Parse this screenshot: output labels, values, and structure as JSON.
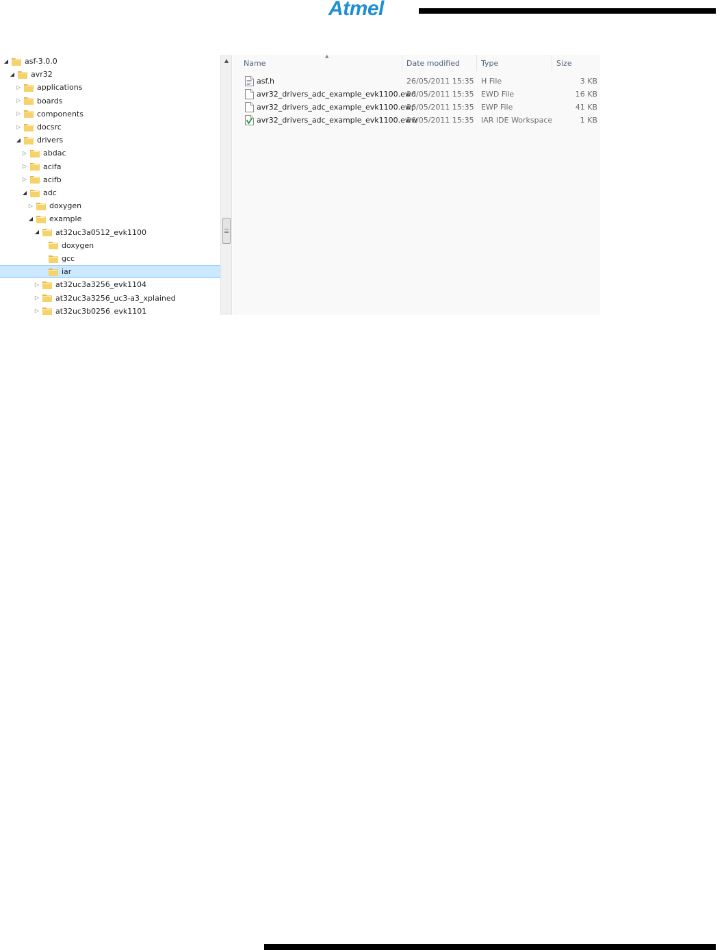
{
  "header": {
    "logo_text": "Atmel"
  },
  "explorer": {
    "tree": [
      {
        "label": "asf-3.0.0",
        "depth": 0,
        "state": "expanded",
        "selected": false
      },
      {
        "label": "avr32",
        "depth": 1,
        "state": "expanded",
        "selected": false
      },
      {
        "label": "applications",
        "depth": 2,
        "state": "collapsed",
        "selected": false
      },
      {
        "label": "boards",
        "depth": 2,
        "state": "collapsed",
        "selected": false
      },
      {
        "label": "components",
        "depth": 2,
        "state": "collapsed",
        "selected": false
      },
      {
        "label": "docsrc",
        "depth": 2,
        "state": "collapsed",
        "selected": false
      },
      {
        "label": "drivers",
        "depth": 2,
        "state": "expanded",
        "selected": false
      },
      {
        "label": "abdac",
        "depth": 3,
        "state": "collapsed",
        "selected": false
      },
      {
        "label": "acifa",
        "depth": 3,
        "state": "collapsed",
        "selected": false
      },
      {
        "label": "acifb",
        "depth": 3,
        "state": "collapsed",
        "selected": false
      },
      {
        "label": "adc",
        "depth": 3,
        "state": "expanded",
        "selected": false
      },
      {
        "label": "doxygen",
        "depth": 4,
        "state": "collapsed",
        "selected": false
      },
      {
        "label": "example",
        "depth": 4,
        "state": "expanded",
        "selected": false
      },
      {
        "label": "at32uc3a0512_evk1100",
        "depth": 5,
        "state": "expanded",
        "selected": false
      },
      {
        "label": "doxygen",
        "depth": 6,
        "state": "none",
        "selected": false
      },
      {
        "label": "gcc",
        "depth": 6,
        "state": "none",
        "selected": false
      },
      {
        "label": "iar",
        "depth": 6,
        "state": "none",
        "selected": true
      },
      {
        "label": "at32uc3a3256_evk1104",
        "depth": 5,
        "state": "collapsed",
        "selected": false
      },
      {
        "label": "at32uc3a3256_uc3-a3_xplained",
        "depth": 5,
        "state": "collapsed",
        "selected": false
      },
      {
        "label": "at32uc3b0256_evk1101",
        "depth": 5,
        "state": "collapsed",
        "selected": false
      }
    ],
    "columns": {
      "name": "Name",
      "date": "Date modified",
      "type": "Type",
      "size": "Size"
    },
    "files": [
      {
        "name": "asf.h",
        "date": "26/05/2011 15:35",
        "type": "H File",
        "size": "3 KB",
        "icon": "text-file-icon"
      },
      {
        "name": "avr32_drivers_adc_example_evk1100.ewd",
        "date": "26/05/2011 15:35",
        "type": "EWD File",
        "size": "16 KB",
        "icon": "blank-file-icon"
      },
      {
        "name": "avr32_drivers_adc_example_evk1100.ewp",
        "date": "26/05/2011 15:35",
        "type": "EWP File",
        "size": "41 KB",
        "icon": "blank-file-icon"
      },
      {
        "name": "avr32_drivers_adc_example_evk1100.eww",
        "date": "26/05/2011 15:35",
        "type": "IAR IDE Workspace",
        "size": "1 KB",
        "icon": "iar-workspace-icon"
      }
    ],
    "colors": {
      "selection": "#cce8ff",
      "folder": "#f3c85a",
      "header_text": "#4c607a"
    }
  }
}
